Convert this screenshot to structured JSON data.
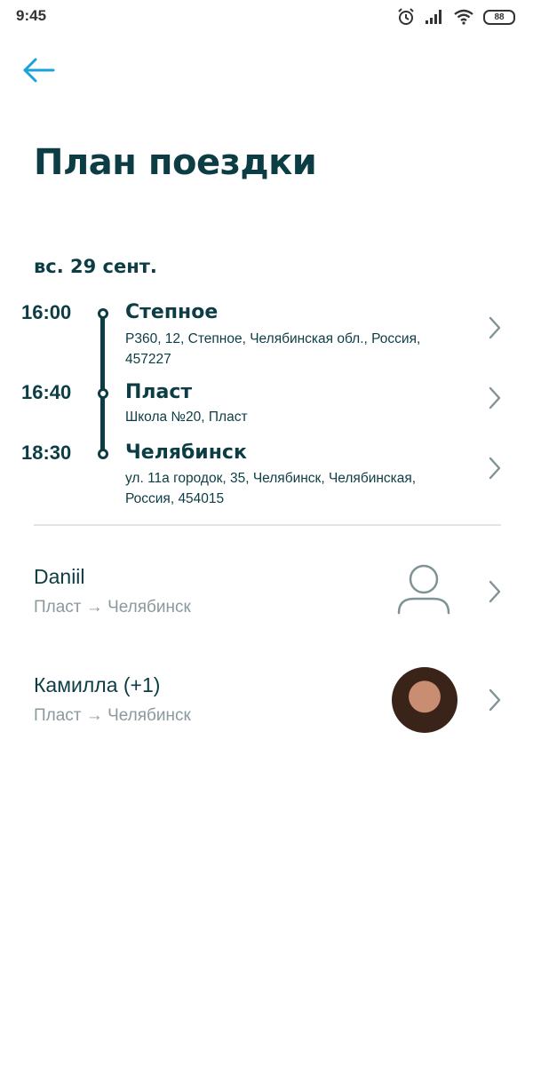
{
  "status_bar": {
    "time": "9:45",
    "battery": "88"
  },
  "header": {
    "title": "План поездки"
  },
  "trip": {
    "date": "вс. 29 сент.",
    "stops": [
      {
        "time": "16:00",
        "name": "Степное",
        "address": "Р360, 12, Степное, Челябинская обл., Россия, 457227"
      },
      {
        "time": "16:40",
        "name": "Пласт",
        "address": "Школа №20, Пласт"
      },
      {
        "time": "18:30",
        "name": "Челябинск",
        "address": "ул. 11а городок, 35, Челябинск, Челябинская, Россия, 454015"
      }
    ]
  },
  "passengers": [
    {
      "name": "Daniil",
      "route": "Пласт → Челябинск",
      "avatar": "person-outline-icon"
    },
    {
      "name": "Камилла (+1)",
      "route": "Пласт → Челябинск",
      "avatar": "photo"
    }
  ],
  "colors": {
    "primary": "#0d3d44",
    "accent": "#1aa3d9",
    "muted": "#8a9a9d"
  }
}
